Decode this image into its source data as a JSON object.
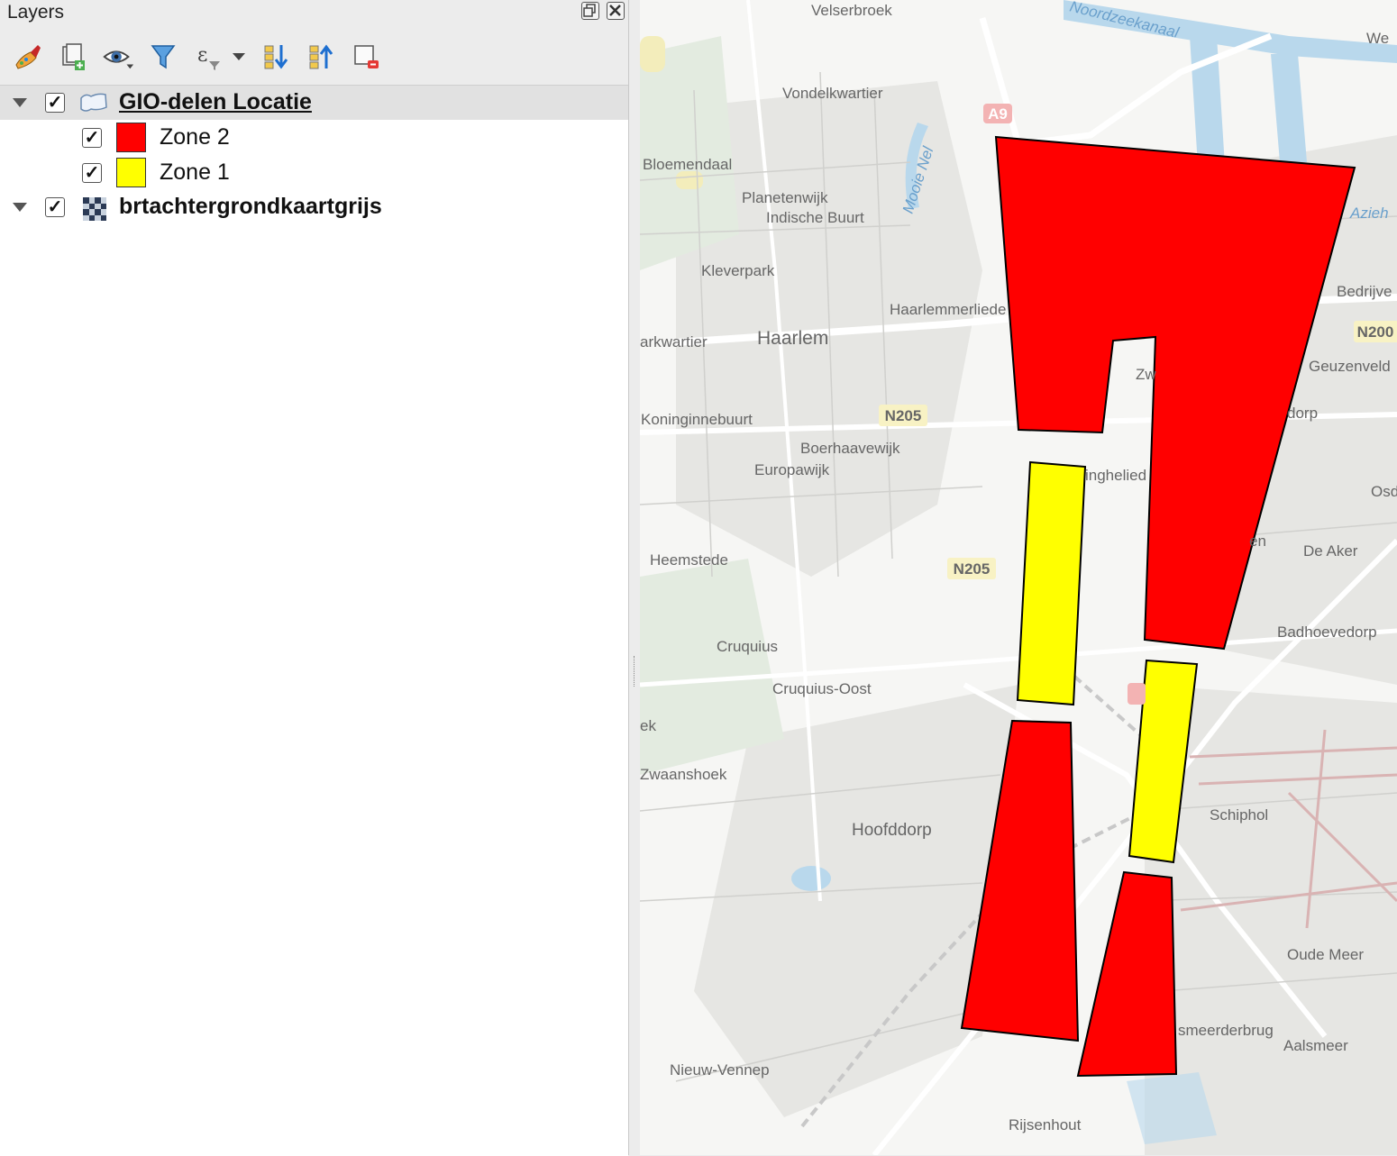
{
  "panel": {
    "title": "Layers"
  },
  "toolbar": {
    "buttons": [
      {
        "icon": "open-layer-styling-icon"
      },
      {
        "icon": "add-group-icon"
      },
      {
        "icon": "manage-visibility-icon"
      },
      {
        "icon": "filter-legend-icon"
      },
      {
        "icon": "filter-by-expression-icon"
      },
      {
        "icon": "expand-all-icon"
      },
      {
        "icon": "collapse-all-icon"
      },
      {
        "icon": "remove-layer-icon"
      }
    ]
  },
  "layers": [
    {
      "name": "GIO-delen Locatie",
      "checked": true,
      "expanded": true,
      "selected": true,
      "type": "polygon",
      "children": [
        {
          "label": "Zone 2",
          "checked": true,
          "color": "#ff0000"
        },
        {
          "label": "Zone 1",
          "checked": true,
          "color": "#ffff00"
        }
      ]
    },
    {
      "name": "brtachtergrondkaartgrijs",
      "checked": true,
      "expanded": false,
      "selected": false,
      "type": "raster"
    }
  ],
  "map": {
    "place_labels": [
      "Velserbroek",
      "Vondelkwartier",
      "Bloemendaal",
      "Planetenwijk",
      "Indische Buurt",
      "Kleverpark",
      "Haarlemmerliede",
      "Haarlem",
      "arkwartier",
      "Koninginnebuurt",
      "Boerhaavewijk",
      "Europawijk",
      "Heemstede",
      "Cruquius",
      "Cruquius-Oost",
      "ek",
      "Zwaanshoek",
      "Hoofddorp",
      "Nieuw-Vennep",
      "Rijsenhout",
      "Schiphol",
      "Oude Meer",
      "Aalsmeer",
      "smeerderbrug",
      "De Aker",
      "Badhoevedorp",
      "Osd",
      "Geuzenveld",
      "Bedrijve",
      "We",
      "dorp",
      "Zw",
      "inghelied",
      "en"
    ],
    "water_labels": [
      "Noordzeekanaal",
      "Mooie Nel",
      "Azieh"
    ],
    "road_labels": [
      "A9",
      "N205",
      "N205",
      "N200"
    ],
    "zone_colors": {
      "zone2": "#ff0000",
      "zone1": "#ffff00"
    }
  }
}
